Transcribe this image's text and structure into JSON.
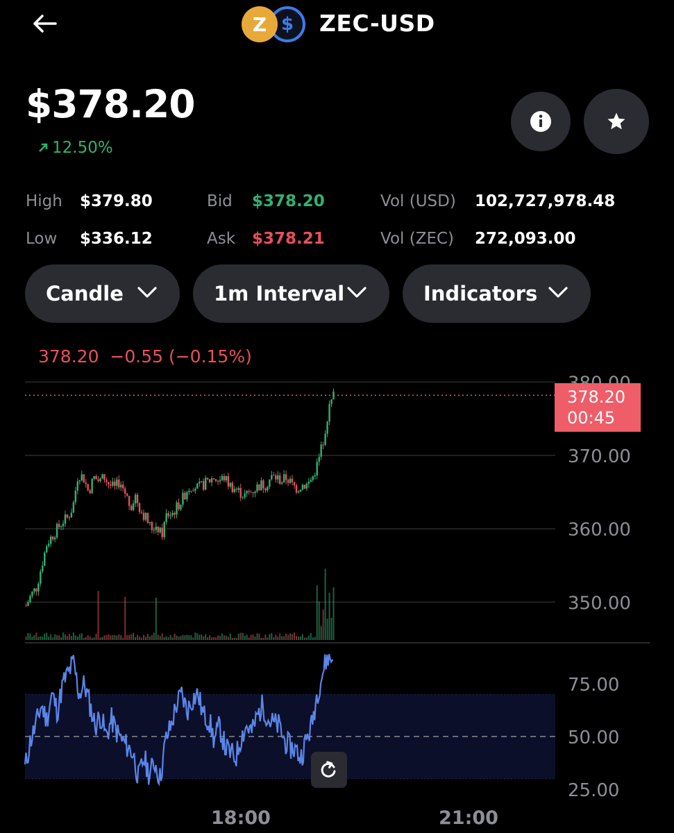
{
  "header": {
    "pair": "ZEC-USD",
    "base_icon_glyph": "Z",
    "quote_icon_glyph": "$",
    "base_icon": "zcash-coin-icon",
    "quote_icon": "usd-coin-icon"
  },
  "price": {
    "value": "$378.20",
    "change_pct": "12.50%",
    "change_direction": "up"
  },
  "stats": {
    "high_label": "High",
    "high_value": "$379.80",
    "low_label": "Low",
    "low_value": "$336.12",
    "bid_label": "Bid",
    "bid_value": "$378.20",
    "ask_label": "Ask",
    "ask_value": "$378.21",
    "vol_usd_label": "Vol (USD)",
    "vol_usd_value": "102,727,978.48",
    "vol_zec_label": "Vol (ZEC)",
    "vol_zec_value": "272,093.00"
  },
  "controls": {
    "chart_type": "Candle",
    "interval": "1m Interval",
    "indicators": "Indicators"
  },
  "chart_legend": {
    "last": "378.20",
    "change": "−0.55",
    "change_pct": "(−0.15%)"
  },
  "price_tag": {
    "price": "378.20",
    "countdown": "00:45"
  },
  "colors": {
    "up": "#33b173",
    "down": "#e8505b",
    "rsi_line": "#5b86e8",
    "accent_tag": "#ef5d68",
    "background": "#000000"
  },
  "chart_data": [
    {
      "type": "candlestick",
      "y_axis_labels": [
        "380.00",
        "370.00",
        "360.00",
        "350.00"
      ],
      "ylim": [
        345.5,
        380.5
      ],
      "x_axis_labels": [
        "18:00",
        "21:00"
      ],
      "x_points": [
        "18:00",
        "21:00"
      ],
      "last_price": 378.2,
      "close_path": [
        349.5,
        351,
        352,
        355,
        358,
        359,
        360,
        361,
        361.5,
        363,
        367.5,
        367,
        365,
        367,
        366.5,
        367,
        366,
        365.5,
        366.5,
        365,
        363,
        364.5,
        362.5,
        361.5,
        360,
        360.5,
        359,
        362,
        362,
        363,
        364,
        365.5,
        366,
        365.5,
        366,
        366.5,
        367,
        366.5,
        367,
        366,
        365.5,
        365,
        364.5,
        365,
        365.5,
        366,
        366,
        367,
        367,
        366.5,
        367,
        366,
        365.5,
        366,
        366,
        367,
        369,
        372,
        376,
        378.2
      ],
      "volume": "small bars along bottom of price pane with spikes near 18:00 and near the end"
    },
    {
      "type": "line",
      "name": "RSI",
      "y_axis_labels": [
        "75.00",
        "50.00",
        "25.00"
      ],
      "ylim": [
        23,
        90
      ],
      "band": [
        30,
        70
      ],
      "midline": 50,
      "values": [
        35,
        48,
        55,
        65,
        58,
        70,
        62,
        75,
        80,
        85,
        70,
        75,
        65,
        55,
        60,
        50,
        58,
        52,
        48,
        45,
        42,
        30,
        40,
        32,
        38,
        30,
        48,
        55,
        65,
        70,
        62,
        68,
        70,
        60,
        58,
        48,
        55,
        45,
        42,
        40,
        50,
        55,
        52,
        60,
        65,
        58,
        56,
        55,
        48,
        45,
        44,
        40,
        48,
        55,
        70,
        80,
        88,
        86
      ]
    }
  ]
}
